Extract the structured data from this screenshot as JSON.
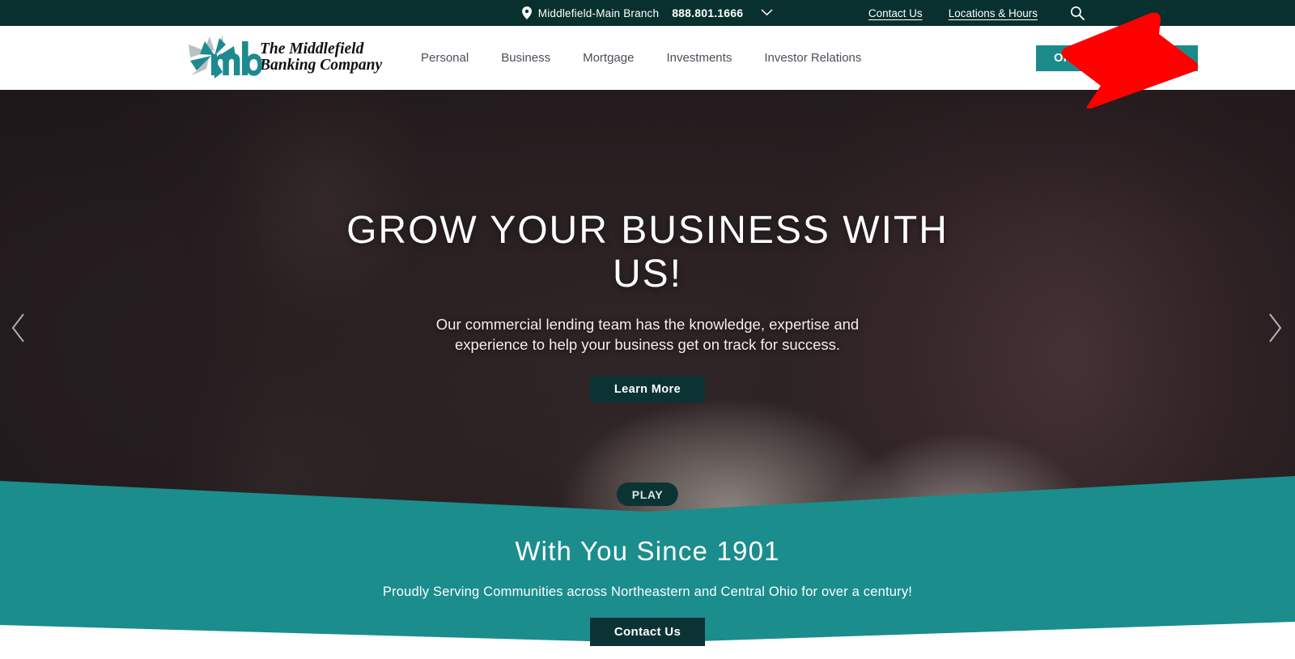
{
  "topbar": {
    "pin_icon": "location-pin-icon",
    "branch": "Middlefield-Main Branch",
    "phone": "888.801.1666",
    "caret_icon": "chevron-down-icon",
    "contact_link": "Contact Us",
    "locations_link": "Locations & Hours",
    "search_icon": "search-icon"
  },
  "header": {
    "logo_star_icon": "mb-star-logo-icon",
    "logo_line1": "The Middlefield",
    "logo_line2": "Banking Company",
    "nav": [
      {
        "label": "Personal"
      },
      {
        "label": "Business"
      },
      {
        "label": "Mortgage"
      },
      {
        "label": "Investments"
      },
      {
        "label": "Investor Relations"
      }
    ],
    "login_label": "Online Banking Login"
  },
  "hero": {
    "title": "GROW YOUR BUSINESS WITH US!",
    "subtitle": "Our commercial lending team has the knowledge, expertise and experience to help your business get on track for success.",
    "cta_label": "Learn More",
    "prev_icon": "chevron-left-icon",
    "next_icon": "chevron-right-icon",
    "dots": [
      {
        "active": true
      },
      {
        "active": false
      },
      {
        "active": false
      }
    ],
    "play_label": "PLAY"
  },
  "promo": {
    "title": "With You Since 1901",
    "subtitle": "Proudly Serving Communities across Northeastern and Central Ohio for over a century!",
    "cta_label": "Contact Us"
  },
  "cursor": {
    "icon": "mouse-pointer-arrow-icon",
    "color": "#fe0000"
  },
  "colors": {
    "topbar_bg": "#08302f",
    "teal": "#1b8d8d",
    "dark_teal": "#0b3334",
    "login_btn": "#1c8a8a",
    "nav_text": "#4a4f57",
    "logo_teal": "#1d8a8f"
  }
}
